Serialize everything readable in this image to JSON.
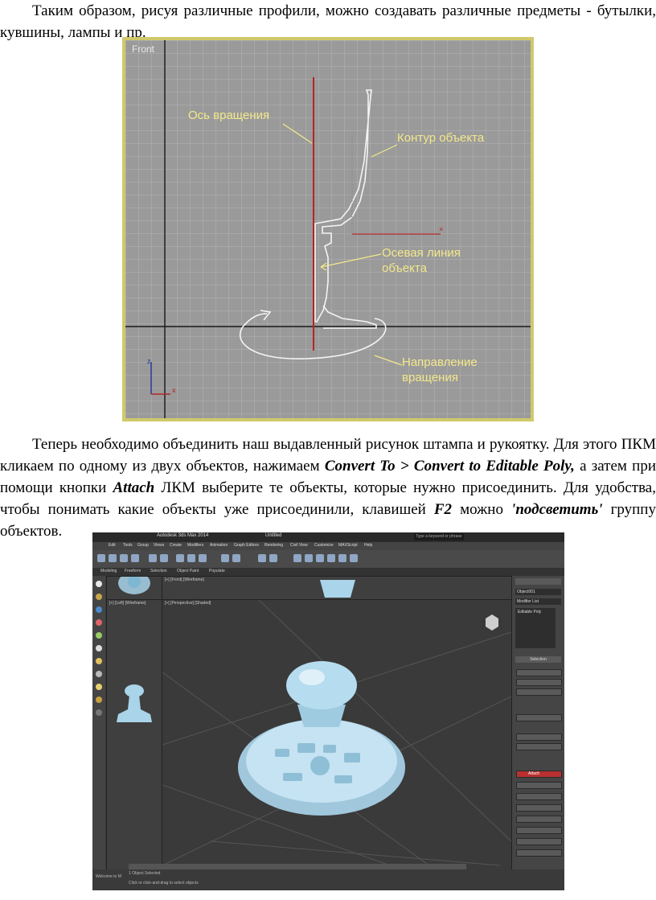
{
  "paragraph1": {
    "text": "Таким образом, рисуя различные профили, можно создавать различные предметы - бутылки, кувшины, лампы и пр."
  },
  "figure1": {
    "viewport_label": "Front",
    "annotations": {
      "axis": "Ось вращения",
      "contour": "Контур объекта",
      "center_line_1": "Осевая линия",
      "center_line_2": "объекта",
      "direction_1": "Направление",
      "direction_2": "вращения"
    },
    "colors": {
      "frame": "#cfc96a",
      "viewport": "#9a9a9a",
      "grid": "#b4b4b4",
      "axis_line": "#b52424",
      "annotation": "#f3e88a"
    }
  },
  "paragraph2": {
    "part1": "Теперь необходимо объединить наш выдавленный рисунок штампа и рукоятку. Для этого ПКМ кликаем по одному из двух объектов, нажимаем ",
    "convert_to": "Convert To > Convert to Editable Poly,",
    "part2": " а затем при помощи кнопки ",
    "attach": "Attach",
    "part3": " ЛКМ выберите те объекты, которые нужно присоединить. Для удобства, чтобы понимать какие объекты уже присоединили, клавишей ",
    "key": "F2",
    "part4": " можно ",
    "highlight": "'подсветить'",
    "part5": " группу объектов."
  },
  "figure2": {
    "title": "Autodesk 3ds Max 2014",
    "file": "Untitled",
    "search_placeholder": "Type a keyword or phrase",
    "menu": [
      "Edit",
      "Tools",
      "Group",
      "Views",
      "Create",
      "Modifiers",
      "Animation",
      "Graph Editors",
      "Rendering",
      "Civil View",
      "Customize",
      "MAXScript",
      "Help"
    ],
    "ribbon": [
      "Modeling",
      "Freeform",
      "Selection",
      "Object Paint",
      "Populate"
    ],
    "viewports": {
      "front": "[+] [Front] [Wireframe]",
      "left": "[+] [Left] [Wireframe]",
      "perspective": "[+] [Perspective] [Shaded]"
    },
    "command_panel": {
      "object_name": "Object001",
      "modifier_list": "Modifier List",
      "stack_item": "Editable Poly",
      "selection": "Selection",
      "attach": "Attach"
    },
    "status": {
      "script": "Welcome to M",
      "selected": "1 Object Selected",
      "prompt": "Click or click-and-drag to select objects"
    },
    "colors": {
      "model": "#a9d4ea",
      "ui_dark": "#3a3a3a"
    }
  }
}
